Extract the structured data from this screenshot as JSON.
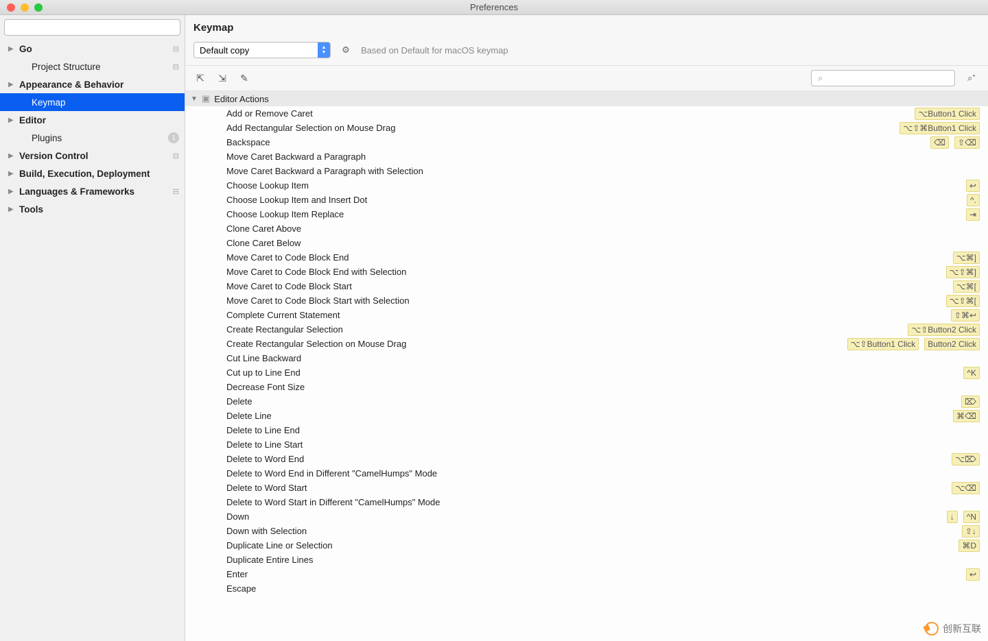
{
  "window": {
    "title": "Preferences"
  },
  "sidebar": {
    "search_placeholder": "",
    "items": [
      {
        "label": "Go",
        "expandable": true,
        "bold": true,
        "badge": "⊟"
      },
      {
        "label": "Project Structure",
        "child": true,
        "badge": "⊟"
      },
      {
        "label": "Appearance & Behavior",
        "expandable": true,
        "bold": true
      },
      {
        "label": "Keymap",
        "child": true,
        "selected": true
      },
      {
        "label": "Editor",
        "expandable": true,
        "bold": true
      },
      {
        "label": "Plugins",
        "child": true,
        "badge_count": "1"
      },
      {
        "label": "Version Control",
        "expandable": true,
        "bold": true,
        "badge": "⊟"
      },
      {
        "label": "Build, Execution, Deployment",
        "expandable": true,
        "bold": true
      },
      {
        "label": "Languages & Frameworks",
        "expandable": true,
        "bold": true,
        "badge": "⊟"
      },
      {
        "label": "Tools",
        "expandable": true,
        "bold": true
      }
    ]
  },
  "content": {
    "title": "Keymap",
    "scheme": "Default copy",
    "based_on": "Based on Default for macOS keymap",
    "action_search_placeholder": "",
    "group": "Editor Actions",
    "actions": [
      {
        "name": "Add or Remove Caret",
        "shortcuts": [
          "⌥Button1 Click"
        ]
      },
      {
        "name": "Add Rectangular Selection on Mouse Drag",
        "shortcuts": [
          "⌥⇧⌘Button1 Click"
        ]
      },
      {
        "name": "Backspace",
        "shortcuts": [
          "⌫",
          "⇧⌫"
        ]
      },
      {
        "name": "Move Caret Backward a Paragraph",
        "shortcuts": []
      },
      {
        "name": "Move Caret Backward a Paragraph with Selection",
        "shortcuts": []
      },
      {
        "name": "Choose Lookup Item",
        "shortcuts": [
          "↩"
        ]
      },
      {
        "name": "Choose Lookup Item and Insert Dot",
        "shortcuts": [
          "^."
        ]
      },
      {
        "name": "Choose Lookup Item Replace",
        "shortcuts": [
          "⇥"
        ]
      },
      {
        "name": "Clone Caret Above",
        "shortcuts": []
      },
      {
        "name": "Clone Caret Below",
        "shortcuts": []
      },
      {
        "name": "Move Caret to Code Block End",
        "shortcuts": [
          "⌥⌘]"
        ]
      },
      {
        "name": "Move Caret to Code Block End with Selection",
        "shortcuts": [
          "⌥⇧⌘]"
        ]
      },
      {
        "name": "Move Caret to Code Block Start",
        "shortcuts": [
          "⌥⌘["
        ]
      },
      {
        "name": "Move Caret to Code Block Start with Selection",
        "shortcuts": [
          "⌥⇧⌘["
        ]
      },
      {
        "name": "Complete Current Statement",
        "shortcuts": [
          "⇧⌘↩"
        ]
      },
      {
        "name": "Create Rectangular Selection",
        "shortcuts": [
          "⌥⇧Button2 Click"
        ]
      },
      {
        "name": "Create Rectangular Selection on Mouse Drag",
        "shortcuts": [
          "⌥⇧Button1 Click",
          "Button2 Click"
        ]
      },
      {
        "name": "Cut Line Backward",
        "shortcuts": []
      },
      {
        "name": "Cut up to Line End",
        "shortcuts": [
          "^K"
        ]
      },
      {
        "name": "Decrease Font Size",
        "shortcuts": []
      },
      {
        "name": "Delete",
        "shortcuts": [
          "⌦"
        ]
      },
      {
        "name": "Delete Line",
        "shortcuts": [
          "⌘⌫"
        ]
      },
      {
        "name": "Delete to Line End",
        "shortcuts": []
      },
      {
        "name": "Delete to Line Start",
        "shortcuts": []
      },
      {
        "name": "Delete to Word End",
        "shortcuts": [
          "⌥⌦"
        ]
      },
      {
        "name": "Delete to Word End in Different \"CamelHumps\" Mode",
        "shortcuts": []
      },
      {
        "name": "Delete to Word Start",
        "shortcuts": [
          "⌥⌫"
        ]
      },
      {
        "name": "Delete to Word Start in Different \"CamelHumps\" Mode",
        "shortcuts": []
      },
      {
        "name": "Down",
        "shortcuts": [
          "↓",
          "^N"
        ]
      },
      {
        "name": "Down with Selection",
        "shortcuts": [
          "⇧↓"
        ]
      },
      {
        "name": "Duplicate Line or Selection",
        "shortcuts": [
          "⌘D"
        ]
      },
      {
        "name": "Duplicate Entire Lines",
        "shortcuts": []
      },
      {
        "name": "Enter",
        "shortcuts": [
          "↩"
        ]
      },
      {
        "name": "Escape",
        "shortcuts": []
      }
    ]
  },
  "watermark": {
    "text": "创新互联"
  }
}
